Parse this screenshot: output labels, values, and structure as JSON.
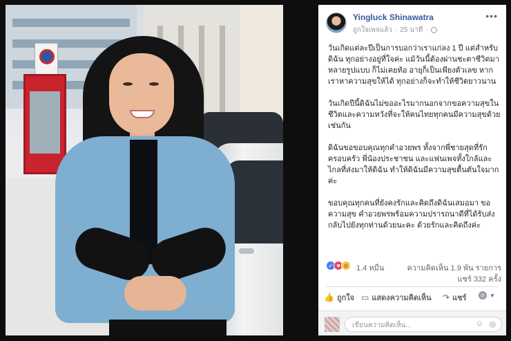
{
  "post": {
    "author": "Yingluck Shinawatra",
    "meta_text": "ถูกใจเพจแล้ว",
    "time": "25 นาที",
    "more_icon": "•••",
    "paragraphs": [
      "วันเกิดแต่ละปีเป็นการบอกว่าเราแก่ลง 1 ปี แต่สำหรับดิฉัน ทุกอย่างอยู่ที่ใจค่ะ แม้วันนี้ต้องผ่านชะตาชีวิตมาหลายรูปแบบ ก็ไม่เคยท้อ อายุก็เป็นเพียงตัวเลข หากเราหาความสุขให้ได้ ทุกอย่างก็จะทำให้ชีวิตยาวนาน",
      "วันเกิดปีนี้ดิฉันไม่ขออะไรมากนอกจากขอความสุขในชีวิตและความหวังที่จะให้คนไทยทุกคนมีความสุขด้วยเช่นกัน",
      "ดิฉันขอขอบคุณทุกคำอวยพร ทั้งจากพี่ชายสุดที่รักครอบครัว พี่น้องประชาชน และแฟนเพจทั้งใกล้และไกลที่ส่งมาให้ดิฉัน ทำให้ดิฉันมีความสุขตื้นตันใจมากค่ะ",
      "ขอบคุณทุกคนที่ยังคงรักและคิดถึงดิฉันเสมอมา ขอความสุข คำอวยพรพร้อมความปรารถนาดีที่ได้รับส่งกลับไปยังทุกท่านด้วยนะคะ ด้วยรักและคิดถึงค่ะ"
    ]
  },
  "reactions": {
    "count": "1.4 หมื่น",
    "comments": "ความคิดเห็น 1.9 พัน รายการ",
    "shares": "แชร์ 332 ครั้ง",
    "icons": [
      "like-icon",
      "love-icon",
      "wow-icon"
    ]
  },
  "actions": {
    "like": "ถูกใจ",
    "comment": "แสดงความคิดเห็น",
    "share": "แชร์"
  },
  "comment_box": {
    "placeholder": "เขียนความคิดเห็น..."
  },
  "colors": {
    "link": "#365899",
    "like": "#4a7bf0",
    "love": "#f0435f",
    "wow": "#f6c543"
  }
}
